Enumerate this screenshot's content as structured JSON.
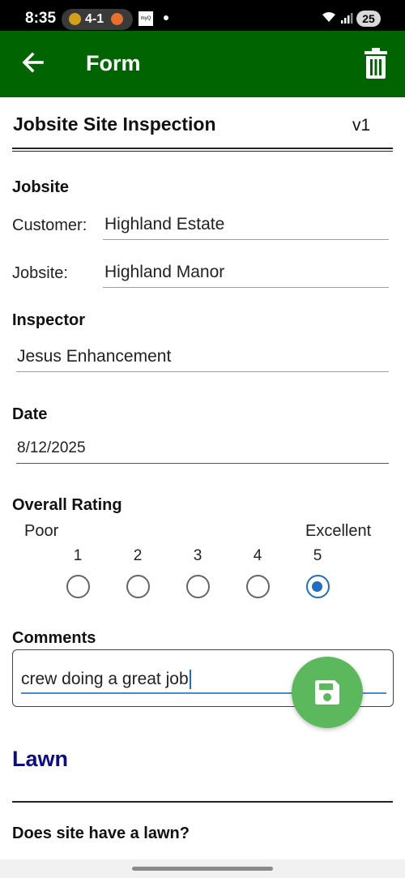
{
  "status_bar": {
    "time": "8:35",
    "score": "4-1",
    "app_label": "myQ",
    "battery": "25"
  },
  "app_bar": {
    "title": "Form",
    "back_icon": "arrow-left-icon",
    "delete_icon": "trash-icon",
    "color": "#006400"
  },
  "form": {
    "title": "Jobsite Site Inspection",
    "version": "v1"
  },
  "jobsite": {
    "heading": "Jobsite",
    "customer_label": "Customer:",
    "customer_value": "Highland Estate",
    "jobsite_label": "Jobsite:",
    "jobsite_value": "Highland Manor"
  },
  "inspector": {
    "heading": "Inspector",
    "value": "Jesus Enhancement"
  },
  "date": {
    "heading": "Date",
    "value": "8/12/2025"
  },
  "rating": {
    "heading": "Overall Rating",
    "low_label": "Poor",
    "high_label": "Excellent",
    "options": [
      "1",
      "2",
      "3",
      "4",
      "5"
    ],
    "selected": "5",
    "accent": "#1e6fc4"
  },
  "comments": {
    "heading": "Comments",
    "value": "crew doing a great job"
  },
  "save_fab": {
    "icon": "floppy-disk-icon",
    "color": "#5cb85c"
  },
  "lawn": {
    "heading": "Lawn",
    "color": "#0a0a8a",
    "question": "Does site have a lawn?"
  }
}
